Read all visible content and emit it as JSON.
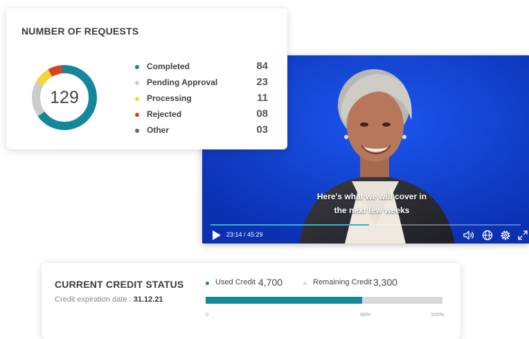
{
  "requests": {
    "title": "NUMBER OF REQUESTS",
    "total": "129",
    "items": [
      {
        "label": "Completed",
        "count": "84",
        "value": 84,
        "color": "#14879a"
      },
      {
        "label": "Pending Approval",
        "count": "23",
        "value": 23,
        "color": "#cccccc"
      },
      {
        "label": "Processing",
        "count": "11",
        "value": 11,
        "color": "#f5d33d"
      },
      {
        "label": "Rejected",
        "count": "08",
        "value": 8,
        "color": "#d84416"
      },
      {
        "label": "Other",
        "count": "03",
        "value": 3,
        "color": "#666666"
      }
    ]
  },
  "video": {
    "caption_line1": "Here's what we will cover in",
    "caption_line2": "the next few weeks",
    "time": "23:14 / 45:29",
    "progress": 0.511,
    "accent": "#2fb6c9",
    "icons": [
      "play-icon",
      "volume-icon",
      "globe-icon",
      "gear-icon",
      "fullscreen-icon"
    ]
  },
  "credit": {
    "title": "CURRENT CREDIT STATUS",
    "expiry_label": "Credit expiration date :",
    "expiry_date": "31.12.21",
    "used_label": "Used Credit",
    "used_value": "4,700",
    "remaining_label": "Remaining Credit",
    "remaining_value": "3,300",
    "used_fraction": 0.66,
    "tick_start": "0",
    "tick_mid": "66%",
    "tick_end": "100%",
    "used_color": "#148a96",
    "remaining_color": "#d8d8d8"
  }
}
